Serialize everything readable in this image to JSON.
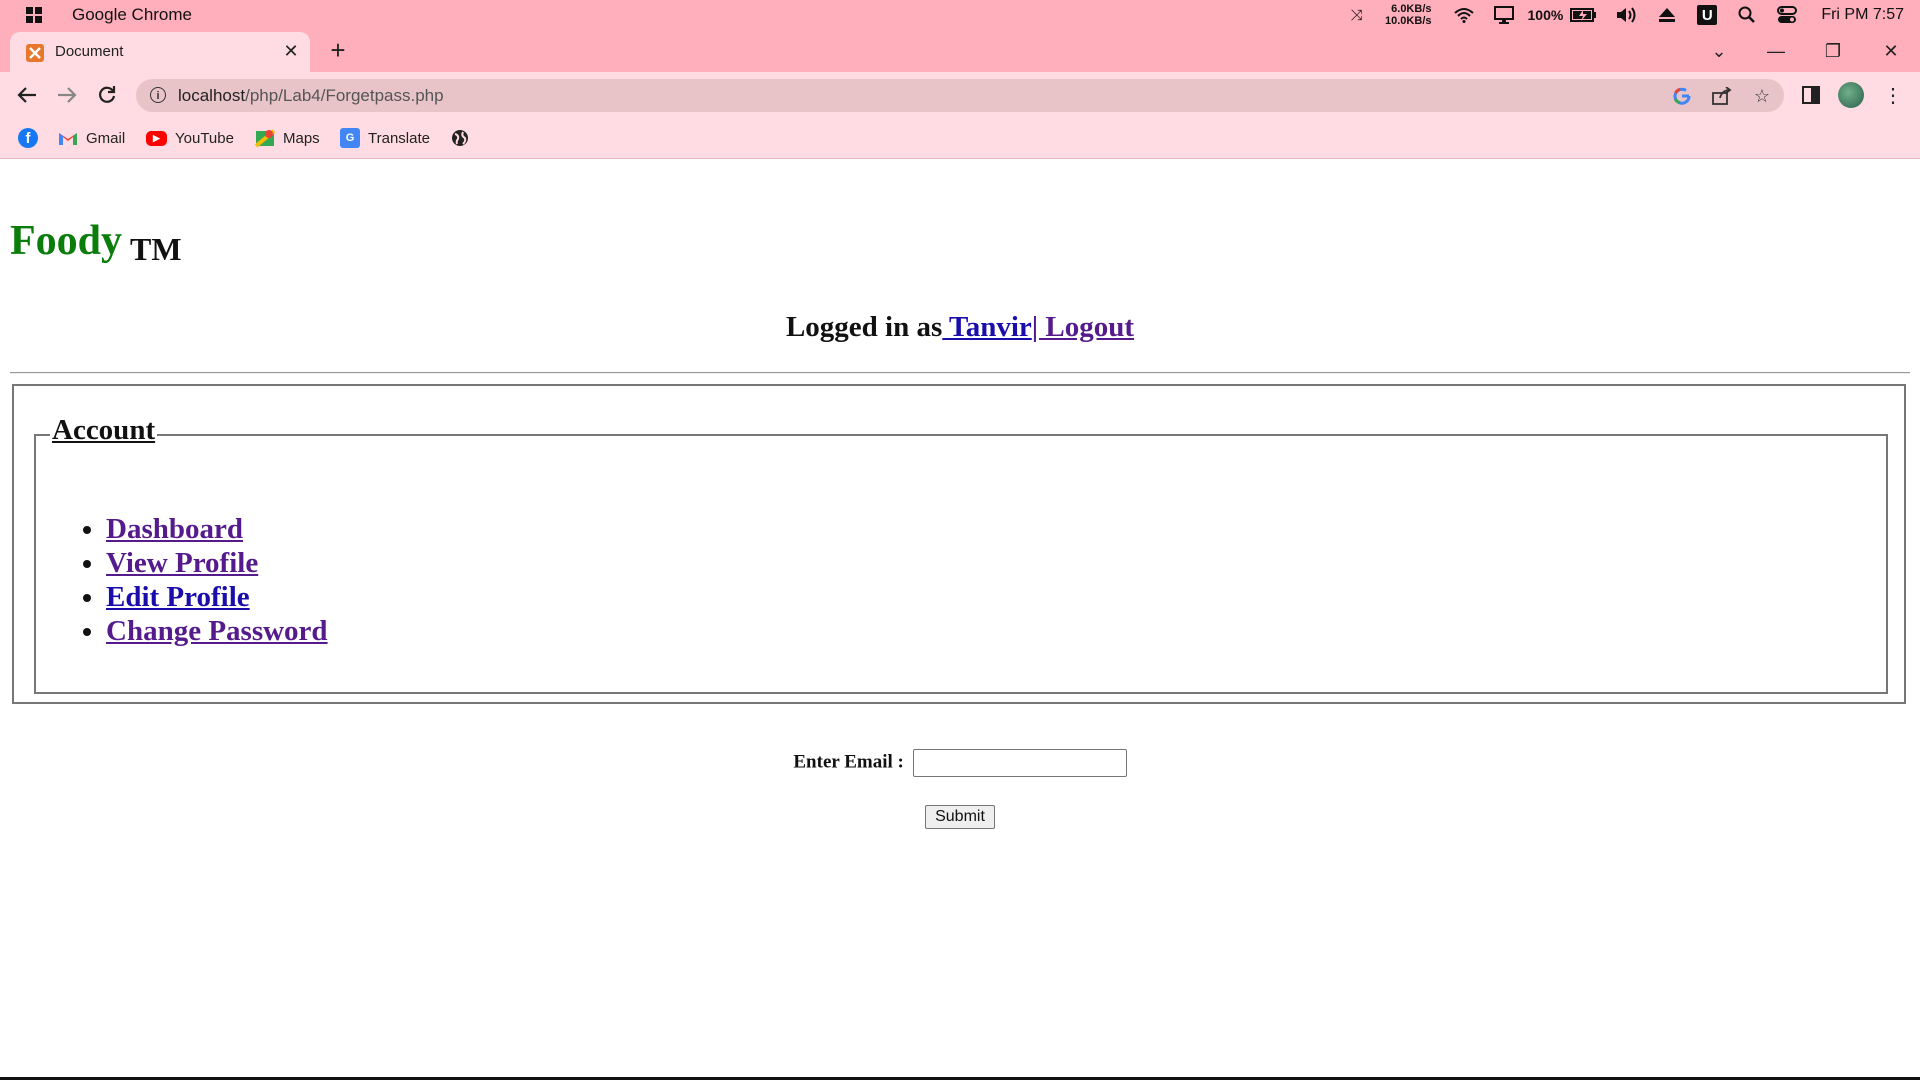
{
  "titlebar": {
    "app_name": "Google Chrome",
    "net_up": "6.0KB/s",
    "net_down": "10.0KB/s",
    "battery": "100%",
    "clock": "Fri PM 7:57",
    "u_label": "U"
  },
  "tab": {
    "title": "Document"
  },
  "toolbar": {
    "url_host": "localhost",
    "url_path": "/php/Lab4/Forgetpass.php"
  },
  "bookmarks": [
    {
      "label": ""
    },
    {
      "label": "Gmail"
    },
    {
      "label": "YouTube"
    },
    {
      "label": "Maps"
    },
    {
      "label": "Translate"
    },
    {
      "label": ""
    }
  ],
  "page": {
    "brand_name": "Foody",
    "brand_tm": "TM",
    "logged_in_prefix": "Logged in as",
    "username": " Tanvir",
    "logout": "| Logout",
    "legend": "Account",
    "menu": [
      {
        "label": "Dashboard"
      },
      {
        "label": "View Profile"
      },
      {
        "label": "Edit Profile"
      },
      {
        "label": "Change Password"
      }
    ],
    "email_label": "Enter Email :",
    "email_value": "",
    "submit_label": "Submit"
  },
  "colors": {
    "chrome_frame": "#ffaebb",
    "chrome_toolbar": "#ffdce3",
    "brand_green": "#0b7d0b",
    "link_blue": "#1a0dab",
    "link_visited": "#551a8b"
  }
}
